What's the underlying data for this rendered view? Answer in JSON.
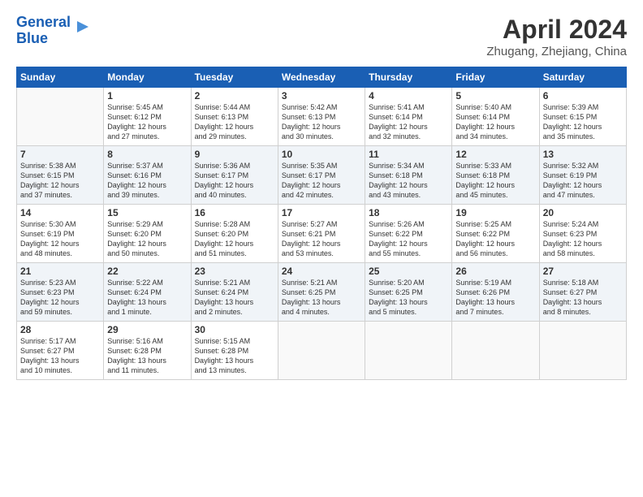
{
  "header": {
    "logo_line1": "General",
    "logo_line2": "Blue",
    "month": "April 2024",
    "location": "Zhugang, Zhejiang, China"
  },
  "days_of_week": [
    "Sunday",
    "Monday",
    "Tuesday",
    "Wednesday",
    "Thursday",
    "Friday",
    "Saturday"
  ],
  "weeks": [
    [
      {
        "num": "",
        "text": ""
      },
      {
        "num": "1",
        "text": "Sunrise: 5:45 AM\nSunset: 6:12 PM\nDaylight: 12 hours\nand 27 minutes."
      },
      {
        "num": "2",
        "text": "Sunrise: 5:44 AM\nSunset: 6:13 PM\nDaylight: 12 hours\nand 29 minutes."
      },
      {
        "num": "3",
        "text": "Sunrise: 5:42 AM\nSunset: 6:13 PM\nDaylight: 12 hours\nand 30 minutes."
      },
      {
        "num": "4",
        "text": "Sunrise: 5:41 AM\nSunset: 6:14 PM\nDaylight: 12 hours\nand 32 minutes."
      },
      {
        "num": "5",
        "text": "Sunrise: 5:40 AM\nSunset: 6:14 PM\nDaylight: 12 hours\nand 34 minutes."
      },
      {
        "num": "6",
        "text": "Sunrise: 5:39 AM\nSunset: 6:15 PM\nDaylight: 12 hours\nand 35 minutes."
      }
    ],
    [
      {
        "num": "7",
        "text": "Sunrise: 5:38 AM\nSunset: 6:15 PM\nDaylight: 12 hours\nand 37 minutes."
      },
      {
        "num": "8",
        "text": "Sunrise: 5:37 AM\nSunset: 6:16 PM\nDaylight: 12 hours\nand 39 minutes."
      },
      {
        "num": "9",
        "text": "Sunrise: 5:36 AM\nSunset: 6:17 PM\nDaylight: 12 hours\nand 40 minutes."
      },
      {
        "num": "10",
        "text": "Sunrise: 5:35 AM\nSunset: 6:17 PM\nDaylight: 12 hours\nand 42 minutes."
      },
      {
        "num": "11",
        "text": "Sunrise: 5:34 AM\nSunset: 6:18 PM\nDaylight: 12 hours\nand 43 minutes."
      },
      {
        "num": "12",
        "text": "Sunrise: 5:33 AM\nSunset: 6:18 PM\nDaylight: 12 hours\nand 45 minutes."
      },
      {
        "num": "13",
        "text": "Sunrise: 5:32 AM\nSunset: 6:19 PM\nDaylight: 12 hours\nand 47 minutes."
      }
    ],
    [
      {
        "num": "14",
        "text": "Sunrise: 5:30 AM\nSunset: 6:19 PM\nDaylight: 12 hours\nand 48 minutes."
      },
      {
        "num": "15",
        "text": "Sunrise: 5:29 AM\nSunset: 6:20 PM\nDaylight: 12 hours\nand 50 minutes."
      },
      {
        "num": "16",
        "text": "Sunrise: 5:28 AM\nSunset: 6:20 PM\nDaylight: 12 hours\nand 51 minutes."
      },
      {
        "num": "17",
        "text": "Sunrise: 5:27 AM\nSunset: 6:21 PM\nDaylight: 12 hours\nand 53 minutes."
      },
      {
        "num": "18",
        "text": "Sunrise: 5:26 AM\nSunset: 6:22 PM\nDaylight: 12 hours\nand 55 minutes."
      },
      {
        "num": "19",
        "text": "Sunrise: 5:25 AM\nSunset: 6:22 PM\nDaylight: 12 hours\nand 56 minutes."
      },
      {
        "num": "20",
        "text": "Sunrise: 5:24 AM\nSunset: 6:23 PM\nDaylight: 12 hours\nand 58 minutes."
      }
    ],
    [
      {
        "num": "21",
        "text": "Sunrise: 5:23 AM\nSunset: 6:23 PM\nDaylight: 12 hours\nand 59 minutes."
      },
      {
        "num": "22",
        "text": "Sunrise: 5:22 AM\nSunset: 6:24 PM\nDaylight: 13 hours\nand 1 minute."
      },
      {
        "num": "23",
        "text": "Sunrise: 5:21 AM\nSunset: 6:24 PM\nDaylight: 13 hours\nand 2 minutes."
      },
      {
        "num": "24",
        "text": "Sunrise: 5:21 AM\nSunset: 6:25 PM\nDaylight: 13 hours\nand 4 minutes."
      },
      {
        "num": "25",
        "text": "Sunrise: 5:20 AM\nSunset: 6:25 PM\nDaylight: 13 hours\nand 5 minutes."
      },
      {
        "num": "26",
        "text": "Sunrise: 5:19 AM\nSunset: 6:26 PM\nDaylight: 13 hours\nand 7 minutes."
      },
      {
        "num": "27",
        "text": "Sunrise: 5:18 AM\nSunset: 6:27 PM\nDaylight: 13 hours\nand 8 minutes."
      }
    ],
    [
      {
        "num": "28",
        "text": "Sunrise: 5:17 AM\nSunset: 6:27 PM\nDaylight: 13 hours\nand 10 minutes."
      },
      {
        "num": "29",
        "text": "Sunrise: 5:16 AM\nSunset: 6:28 PM\nDaylight: 13 hours\nand 11 minutes."
      },
      {
        "num": "30",
        "text": "Sunrise: 5:15 AM\nSunset: 6:28 PM\nDaylight: 13 hours\nand 13 minutes."
      },
      {
        "num": "",
        "text": ""
      },
      {
        "num": "",
        "text": ""
      },
      {
        "num": "",
        "text": ""
      },
      {
        "num": "",
        "text": ""
      }
    ]
  ]
}
